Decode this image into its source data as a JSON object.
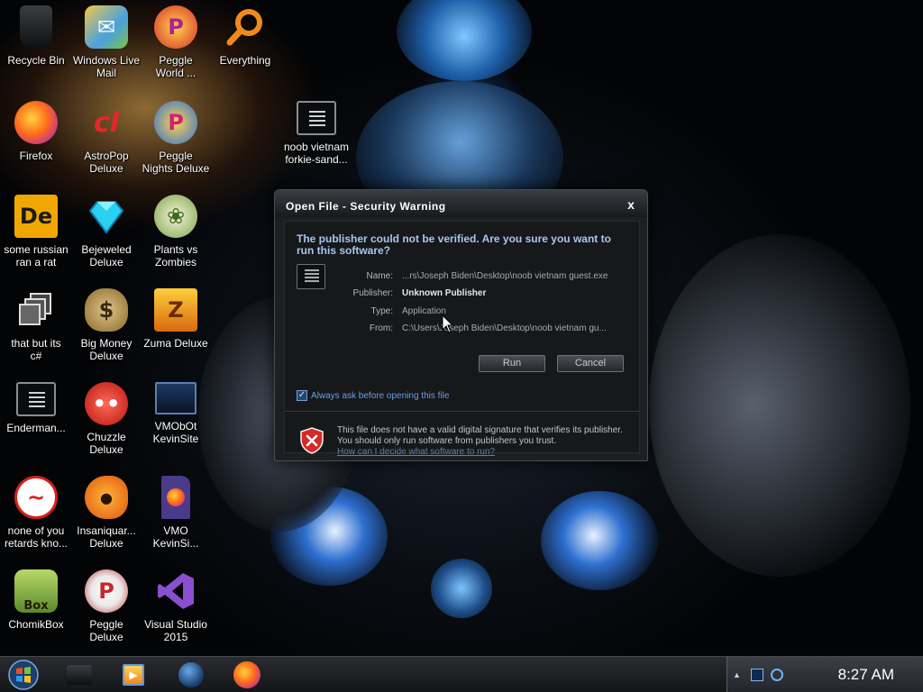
{
  "desktop": {
    "icons": [
      {
        "label": "Recycle Bin",
        "icon": "recycle-bin-icon"
      },
      {
        "label": "Windows Live\nMail",
        "icon": "windows-live-mail-icon"
      },
      {
        "label": "Peggle\nWorld ...",
        "icon": "peggle-world-icon"
      },
      {
        "label": "Everything",
        "icon": "everything-search-icon"
      },
      {
        "label": "Firefox",
        "icon": "firefox-icon"
      },
      {
        "label": "AstroPop\nDeluxe",
        "icon": "astropop-icon"
      },
      {
        "label": "Peggle\nNights Deluxe",
        "icon": "peggle-nights-icon"
      },
      {
        "label": "noob vietnam\nforkie-sand...",
        "icon": "executable-file-icon"
      },
      {
        "label": "some russian\nran a rat",
        "icon": "de-app-icon"
      },
      {
        "label": "Bejeweled\nDeluxe",
        "icon": "bejeweled-icon"
      },
      {
        "label": "Plants vs\nZombies",
        "icon": "plants-vs-zombies-icon"
      },
      {
        "label": "that but its\nc#",
        "icon": "multi-window-icon"
      },
      {
        "label": "Big Money\nDeluxe",
        "icon": "money-bag-icon"
      },
      {
        "label": "Zuma Deluxe",
        "icon": "zuma-icon"
      },
      {
        "label": "Enderman...",
        "icon": "executable-file-icon"
      },
      {
        "label": "Chuzzle\nDeluxe",
        "icon": "chuzzle-icon"
      },
      {
        "label": "VMObOt\nKevinSite",
        "icon": "vm-monitor-icon"
      },
      {
        "label": "none of you\nretards kno...",
        "icon": "red-dragon-icon"
      },
      {
        "label": "Insaniquar...\nDeluxe",
        "icon": "goldfish-icon"
      },
      {
        "label": "VMO\nKevinSi...",
        "icon": "firefox-file-icon"
      },
      {
        "label": "ChomikBox",
        "icon": "chomikbox-icon"
      },
      {
        "label": "Peggle\nDeluxe",
        "icon": "peggle-icon"
      },
      {
        "label": "Visual Studio\n2015",
        "icon": "visual-studio-icon"
      }
    ]
  },
  "dialog": {
    "title": "Open File - Security Warning",
    "close_glyph": "x",
    "question": "The publisher could not be verified.  Are you sure you want to run this software?",
    "fields": [
      {
        "key": "Name:",
        "value": "...rs\\Joseph Biden\\Desktop\\noob vietnam guest.exe",
        "bold": false
      },
      {
        "key": "Publisher:",
        "value": "Unknown Publisher",
        "bold": true
      },
      {
        "key": "Type:",
        "value": "Application",
        "bold": false
      },
      {
        "key": "From:",
        "value": "C:\\Users\\Joseph Biden\\Desktop\\noob vietnam gu...",
        "bold": false
      }
    ],
    "run_label": "Run",
    "cancel_label": "Cancel",
    "always_ask_label": "Always ask before opening this file",
    "always_ask_checked": true,
    "warning_text": "This file does not have a valid digital signature that verifies its publisher.  You should only run software from publishers you trust.",
    "warning_link": "How can I decide what software to run?"
  },
  "taskbar": {
    "pinned": [
      "windows-explorer-icon",
      "media-player-icon",
      "globe-icon",
      "firefox-icon"
    ],
    "clock": "8:27 AM",
    "tray_icons": [
      "show-hidden-icons-arrow",
      "display-icon",
      "network-icon"
    ]
  },
  "colors": {
    "dialog_bg": "#1d1f22",
    "question_text": "#a9c6ef",
    "link": "#6f9de6",
    "taskbar": "#1f2124"
  }
}
